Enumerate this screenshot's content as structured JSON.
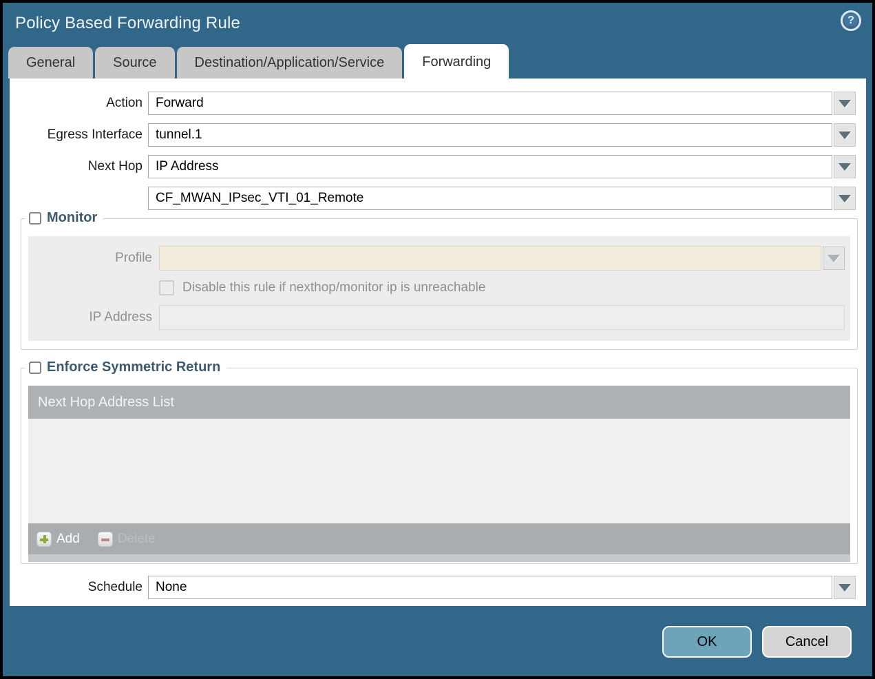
{
  "window": {
    "title": "Policy Based Forwarding Rule",
    "help_glyph": "?"
  },
  "tabs": [
    {
      "label": "General",
      "active": false
    },
    {
      "label": "Source",
      "active": false
    },
    {
      "label": "Destination/Application/Service",
      "active": false
    },
    {
      "label": "Forwarding",
      "active": true
    }
  ],
  "form": {
    "action": {
      "label": "Action",
      "value": "Forward"
    },
    "egress_interface": {
      "label": "Egress Interface",
      "value": "tunnel.1"
    },
    "next_hop": {
      "label": "Next Hop",
      "value": "IP Address"
    },
    "next_hop_address": {
      "value": "CF_MWAN_IPsec_VTI_01_Remote"
    },
    "schedule": {
      "label": "Schedule",
      "value": "None"
    }
  },
  "monitor": {
    "legend": "Monitor",
    "checked": false,
    "profile": {
      "label": "Profile",
      "value": ""
    },
    "disable_rule_label": "Disable this rule if nexthop/monitor ip is unreachable",
    "disable_rule_checked": false,
    "ip_address": {
      "label": "IP Address",
      "value": ""
    }
  },
  "symmetric_return": {
    "legend": "Enforce Symmetric Return",
    "checked": false,
    "table_header": "Next Hop Address List",
    "rows": [],
    "add_label": "Add",
    "delete_label": "Delete",
    "delete_enabled": false
  },
  "footer": {
    "ok_label": "OK",
    "cancel_label": "Cancel"
  },
  "colors": {
    "window_teal": "#31688a",
    "active_tab": "#ffffff",
    "inactive_tab": "#c7c7c7",
    "legend_text": "#3d5a6e",
    "disabled_field_beige": "#f2ecdc",
    "table_header_gray": "#aeb2b5",
    "add_icon_green": "#8ca93d",
    "delete_icon_red": "#c2828a",
    "ok_button": "#6ea4ba",
    "cancel_button": "#d4d4d4"
  }
}
